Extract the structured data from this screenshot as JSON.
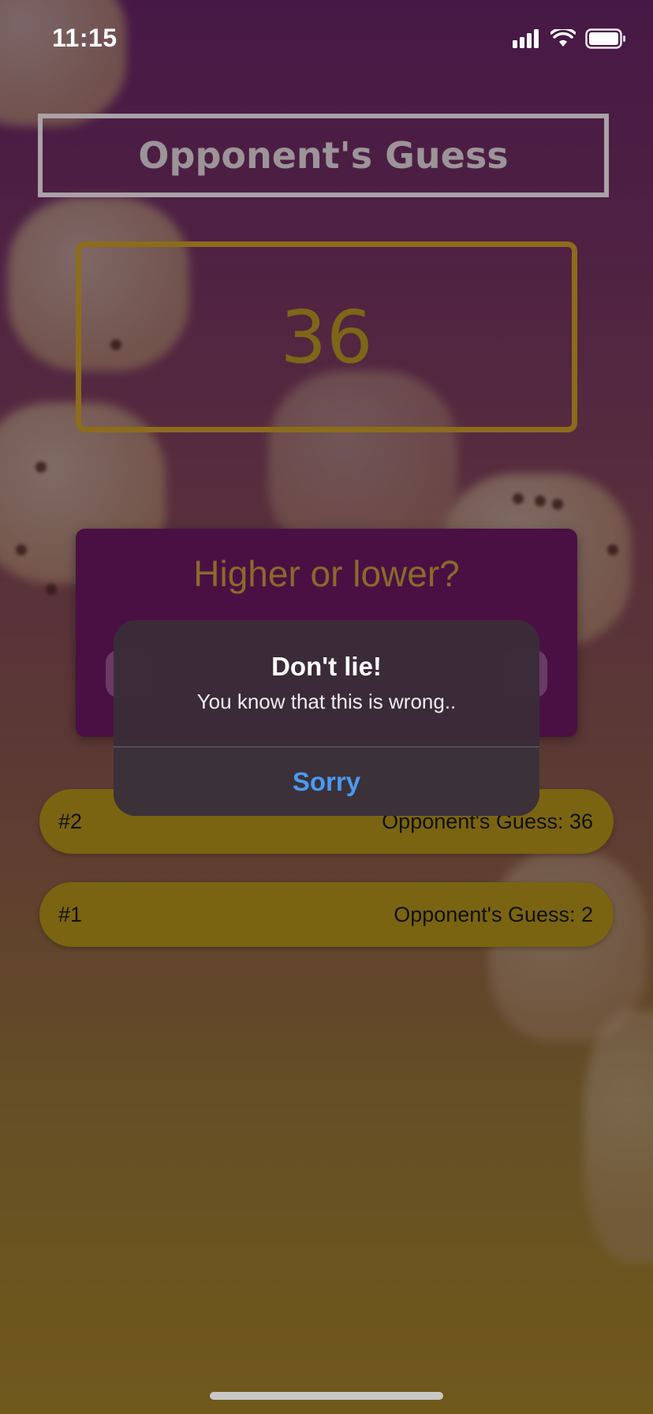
{
  "status": {
    "time": "11:15"
  },
  "screen_title": "Opponent's Guess",
  "current_guess": "36",
  "prompt": {
    "title": "Higher or lower?"
  },
  "log": [
    {
      "index": "#2",
      "text": "Opponent's Guess: 36"
    },
    {
      "index": "#1",
      "text": "Opponent's Guess: 2"
    }
  ],
  "alert": {
    "title": "Don't lie!",
    "message": "You know that this is wrong..",
    "button": "Sorry"
  },
  "colors": {
    "alert_button": "#4a9bf5",
    "log_pill": "#7a6412",
    "card": "#4a1044"
  }
}
